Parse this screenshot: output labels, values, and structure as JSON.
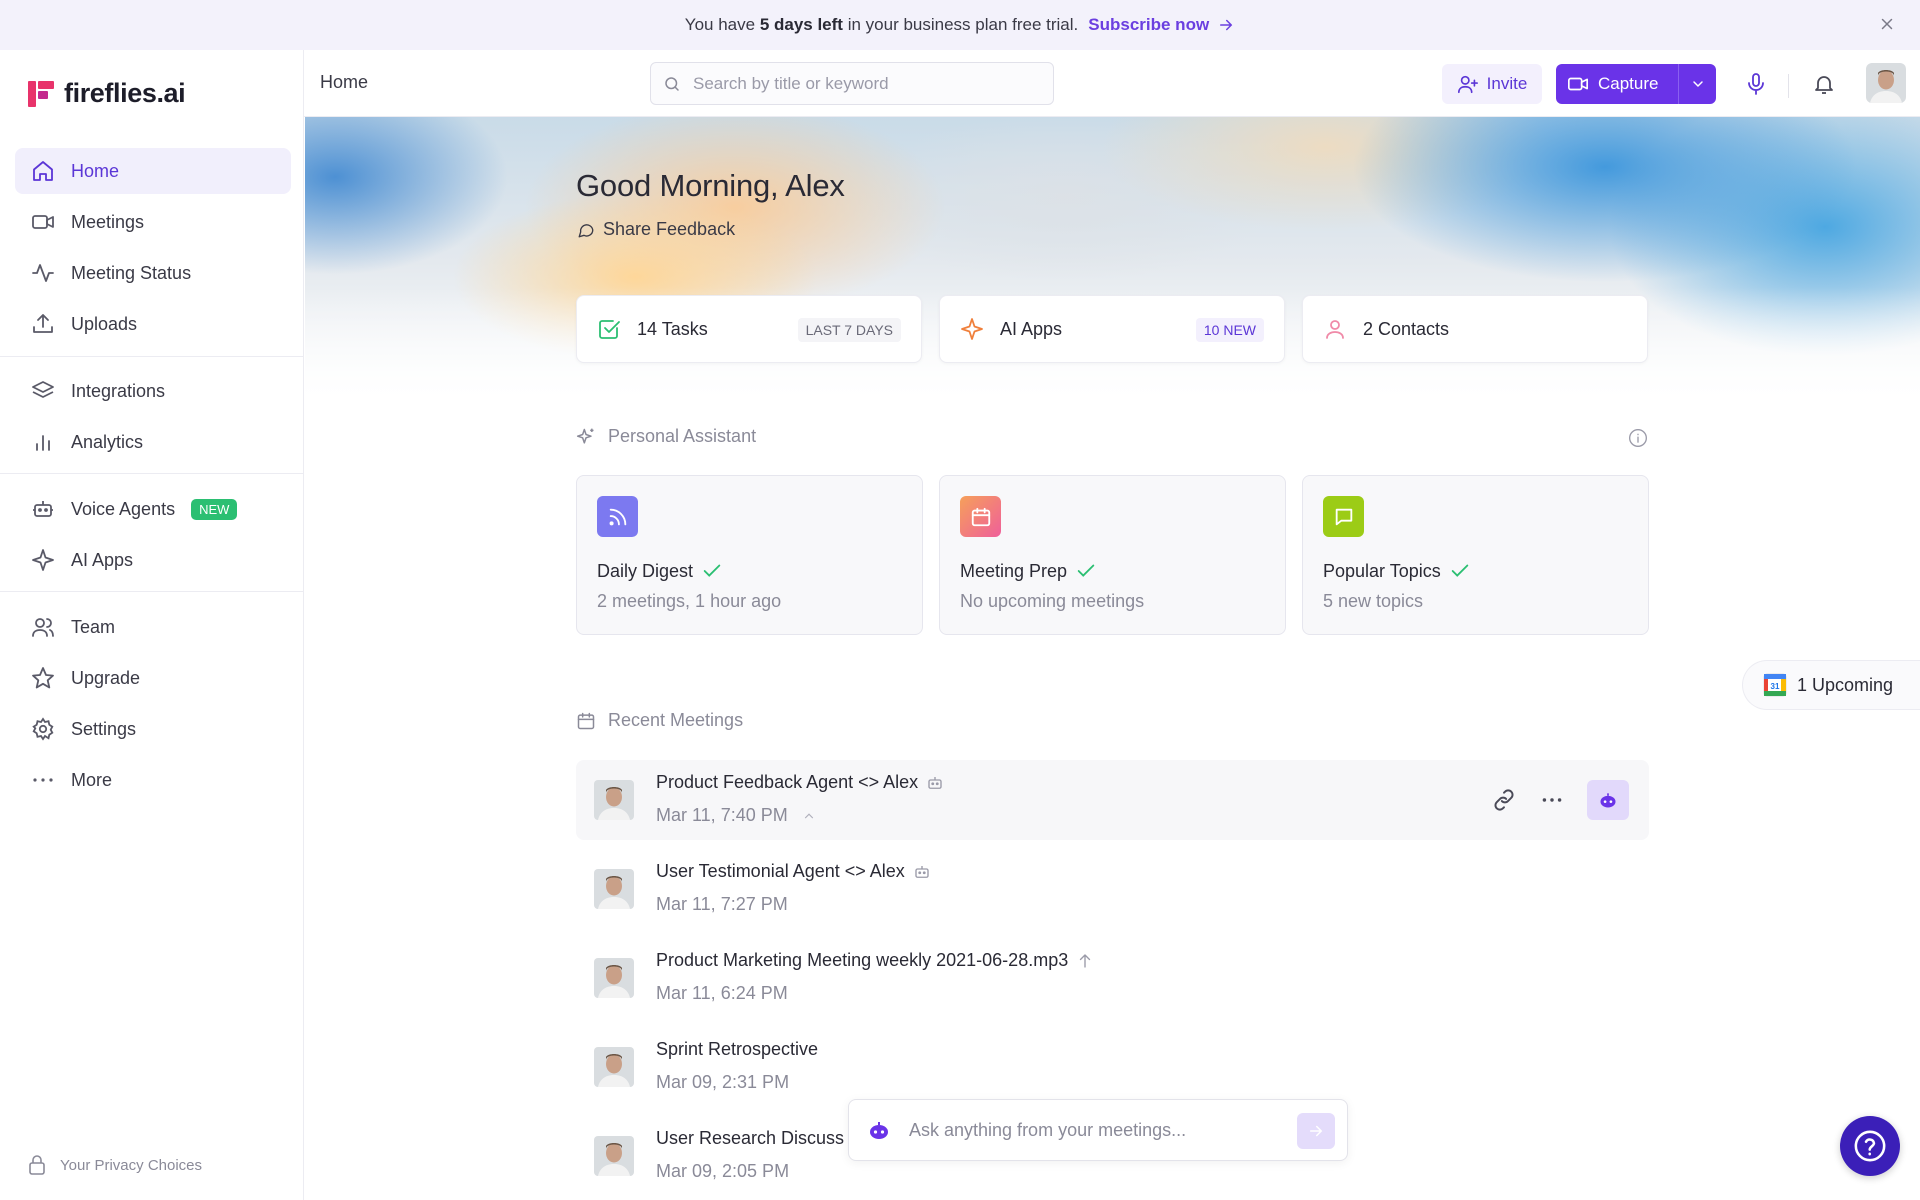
{
  "banner": {
    "pre": "You have",
    "bold": "5 days left",
    "post": "in your business plan free trial.",
    "cta": "Subscribe now"
  },
  "brand": {
    "name": "fireflies.ai",
    "accent": "#6a33e8"
  },
  "sidebar": {
    "items": [
      {
        "label": "Home",
        "icon": "home-icon"
      },
      {
        "label": "Meetings",
        "icon": "video-icon"
      },
      {
        "label": "Meeting Status",
        "icon": "activity-icon"
      },
      {
        "label": "Uploads",
        "icon": "upload-icon"
      },
      {
        "label": "Integrations",
        "icon": "layers-icon"
      },
      {
        "label": "Analytics",
        "icon": "bar-chart-icon"
      },
      {
        "label": "Voice Agents",
        "icon": "bot-icon",
        "badge": "NEW"
      },
      {
        "label": "AI Apps",
        "icon": "sparkle-icon"
      },
      {
        "label": "Team",
        "icon": "users-icon"
      },
      {
        "label": "Upgrade",
        "icon": "star-icon"
      },
      {
        "label": "Settings",
        "icon": "gear-icon"
      },
      {
        "label": "More",
        "icon": "dots-icon"
      }
    ],
    "privacy": "Your Privacy Choices"
  },
  "topbar": {
    "breadcrumb": "Home",
    "search_placeholder": "Search by title or keyword",
    "invite": "Invite",
    "capture": "Capture"
  },
  "hero": {
    "greeting": "Good Morning, Alex",
    "feedback": "Share Feedback"
  },
  "stats": [
    {
      "label": "14 Tasks",
      "tag": "LAST 7 DAYS"
    },
    {
      "label": "AI Apps",
      "tag": "10 NEW"
    },
    {
      "label": "2 Contacts"
    }
  ],
  "assistant": {
    "title": "Personal Assistant",
    "cards": [
      {
        "title": "Daily Digest",
        "subtitle": "2 meetings, 1 hour ago"
      },
      {
        "title": "Meeting Prep",
        "subtitle": "No upcoming meetings"
      },
      {
        "title": "Popular Topics",
        "subtitle": "5 new topics"
      }
    ]
  },
  "upcoming": "1 Upcoming",
  "recent": {
    "title": "Recent Meetings",
    "meetings": [
      {
        "title": "Product Feedback Agent <> Alex",
        "date": "Mar 11, 7:40 PM",
        "icon": "bot-icon"
      },
      {
        "title": "User Testimonial Agent <> Alex",
        "date": "Mar 11, 7:27 PM",
        "icon": "bot-icon"
      },
      {
        "title": "Product Marketing Meeting weekly 2021-06-28.mp3",
        "date": "Mar 11, 6:24 PM",
        "icon": "upload-arrow-icon"
      },
      {
        "title": "Sprint Retrospective",
        "date": "Mar 09, 2:31 PM"
      },
      {
        "title": "User Research Discuss",
        "date": "Mar 09, 2:05 PM"
      }
    ]
  },
  "ask": {
    "placeholder": "Ask anything from your meetings..."
  }
}
